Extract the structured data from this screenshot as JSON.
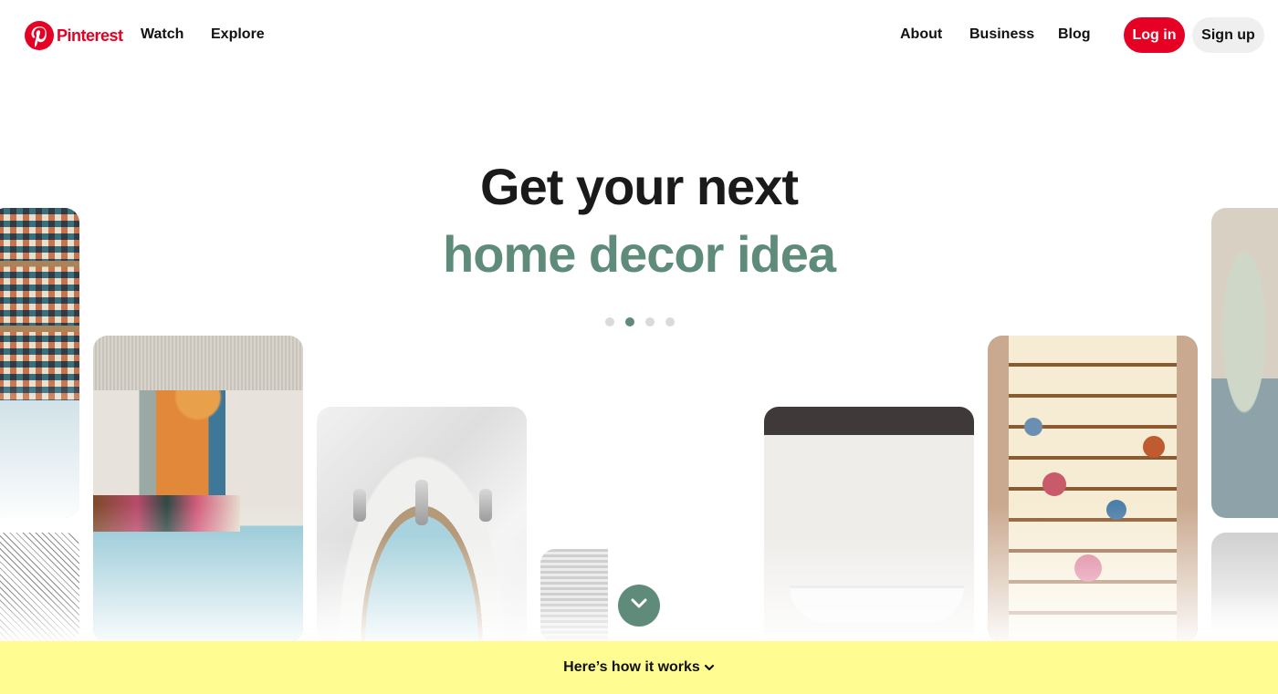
{
  "header": {
    "brand": "Pinterest",
    "logo_icon": "pinterest-logo-icon",
    "nav_left": [
      {
        "label": "Watch"
      },
      {
        "label": "Explore"
      }
    ],
    "nav_right": [
      {
        "label": "About"
      },
      {
        "label": "Business"
      },
      {
        "label": "Blog"
      }
    ],
    "login_label": "Log in",
    "signup_label": "Sign up"
  },
  "hero": {
    "line1": "Get your next",
    "line2": "home decor idea",
    "carousel": {
      "total": 4,
      "active_index": 1
    }
  },
  "gallery": {
    "images": [
      {
        "subject": "patterned tile kitchen with copper pots"
      },
      {
        "subject": "black and white geometric pattern"
      },
      {
        "subject": "bedroom with colorful wall painting and blue bedspread"
      },
      {
        "subject": "marble sink with blue patterned basin"
      },
      {
        "subject": "shower with textured tile and sliding door"
      },
      {
        "subject": "white bathroom with tub and dark ceiling"
      },
      {
        "subject": "staircase with floral wallpaper risers"
      },
      {
        "subject": "room with arched window and floor cushions"
      },
      {
        "subject": "grey interior"
      }
    ],
    "scroll_down_icon": "chevron-down-icon"
  },
  "footer_bar": {
    "label": "Here’s how it works",
    "icon": "chevron-down-icon"
  },
  "colors": {
    "brand_red": "#e60023",
    "accent_green": "#5e8b7a",
    "bar_yellow": "#fffd92",
    "signup_grey": "#efefef"
  }
}
